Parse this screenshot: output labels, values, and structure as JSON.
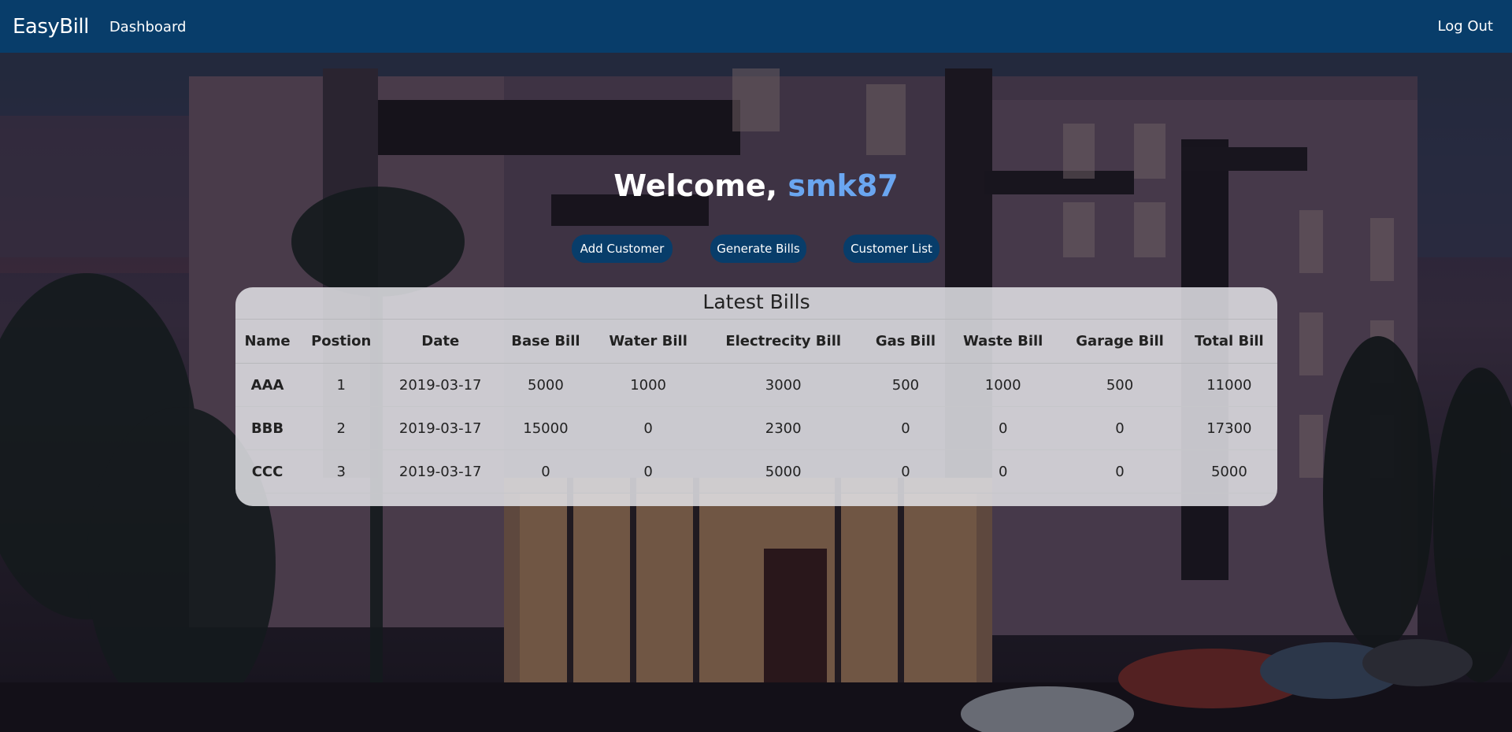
{
  "navbar": {
    "brand": "EasyBill",
    "links": [
      "Dashboard"
    ],
    "logout": "Log Out",
    "color": "#083d6a"
  },
  "welcome": {
    "prefix": "Welcome, ",
    "username": "smk87",
    "username_color": "#6aa6f0"
  },
  "actions": {
    "add_customer": "Add Customer",
    "generate_bills": "Generate Bills",
    "customer_list": "Customer List"
  },
  "bills": {
    "title": "Latest Bills",
    "columns": [
      "Name",
      "Postion",
      "Date",
      "Base Bill",
      "Water Bill",
      "Electrecity Bill",
      "Gas Bill",
      "Waste Bill",
      "Garage Bill",
      "Total Bill"
    ],
    "rows": [
      [
        "AAA",
        "1",
        "2019-03-17",
        "5000",
        "1000",
        "3000",
        "500",
        "1000",
        "500",
        "11000"
      ],
      [
        "BBB",
        "2",
        "2019-03-17",
        "15000",
        "0",
        "2300",
        "0",
        "0",
        "0",
        "17300"
      ],
      [
        "CCC",
        "3",
        "2019-03-17",
        "0",
        "0",
        "5000",
        "0",
        "0",
        "0",
        "5000"
      ]
    ]
  },
  "background": {
    "image": "apartment-building-photo"
  }
}
